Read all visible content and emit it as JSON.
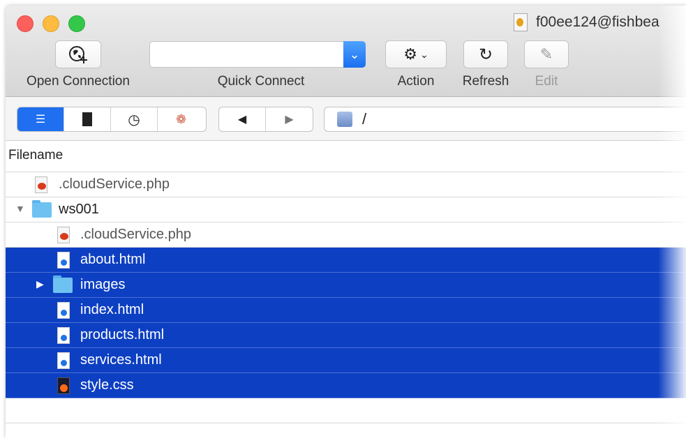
{
  "window": {
    "title": "f00ee124@fishbea"
  },
  "toolbar": {
    "open_connection": "Open Connection",
    "quick_connect": "Quick Connect",
    "quick_connect_value": "",
    "action": "Action",
    "refresh": "Refresh",
    "edit": "Edit"
  },
  "nav": {
    "path": "/",
    "back": "◀",
    "forward": "▶"
  },
  "browser": {
    "column_header": "Filename",
    "rows": [
      {
        "name": ".cloudService.php",
        "type": "php",
        "level": 0,
        "selected": false
      },
      {
        "name": "ws001",
        "type": "folder",
        "level": 0,
        "expanded": true,
        "selected": false
      },
      {
        "name": ".cloudService.php",
        "type": "php",
        "level": 1,
        "selected": false
      },
      {
        "name": "about.html",
        "type": "html",
        "level": 1,
        "selected": true
      },
      {
        "name": "images",
        "type": "folder",
        "level": 1,
        "expanded": false,
        "selected": true
      },
      {
        "name": "index.html",
        "type": "html",
        "level": 1,
        "selected": true
      },
      {
        "name": "products.html",
        "type": "html",
        "level": 1,
        "selected": true
      },
      {
        "name": "services.html",
        "type": "html",
        "level": 1,
        "selected": true
      },
      {
        "name": "style.css",
        "type": "css",
        "level": 1,
        "selected": true
      }
    ]
  },
  "colors": {
    "selection": "#0d3fc2",
    "accent": "#1f6ff0",
    "folder": "#6ec2f2"
  }
}
